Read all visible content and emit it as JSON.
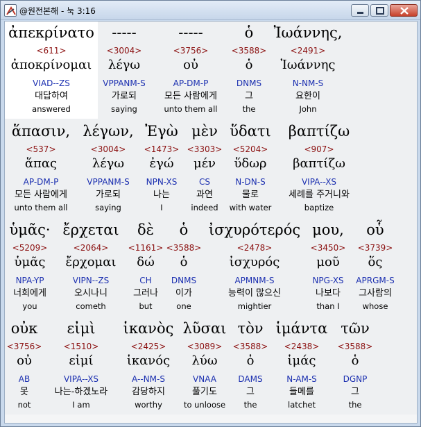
{
  "window": {
    "title": "@원전본해 - 눅 3:16"
  },
  "rows": [
    {
      "words": [
        {
          "surface": "ἀπεκρίνατο",
          "strong": "<611>",
          "lemma": "ἀποκρίνομαι",
          "morph": "VIAD--ZS",
          "korean": "대답하여",
          "english": "answered"
        },
        {
          "surface": "-----",
          "strong": "<3004>",
          "lemma": "λέγω",
          "morph": "VPPANM-S",
          "korean": "가로되",
          "english": "saying"
        },
        {
          "surface": "-----",
          "strong": "<3756>",
          "lemma": "οὐ",
          "morph": "AP-DM-P",
          "korean": "모든 사람에게",
          "english": "unto them all"
        },
        {
          "surface": "ὁ",
          "strong": "<3588>",
          "lemma": "ὁ",
          "morph": "DNMS",
          "korean": "그",
          "english": "the"
        },
        {
          "surface": "Ἰωάννης,",
          "strong": "<2491>",
          "lemma": "Ἰωάννης",
          "morph": "N-NM-S",
          "korean": "요한이",
          "english": "John"
        }
      ]
    },
    {
      "words": [
        {
          "surface": "ἅπασιν,",
          "strong": "<537>",
          "lemma": "ἅπας",
          "morph": "AP-DM-P",
          "korean": "모든 사람에게",
          "english": "unto them all"
        },
        {
          "surface": "λέγων,",
          "strong": "<3004>",
          "lemma": "λέγω",
          "morph": "VPPANM-S",
          "korean": "가로되",
          "english": "saying"
        },
        {
          "surface": "Ἐγὼ",
          "strong": "<1473>",
          "lemma": "ἐγώ",
          "morph": "NPN-XS",
          "korean": "나는",
          "english": "I"
        },
        {
          "surface": "μὲν",
          "strong": "<3303>",
          "lemma": "μέν",
          "morph": "CS",
          "korean": "과연",
          "english": "indeed"
        },
        {
          "surface": "ὕδατι",
          "strong": "<5204>",
          "lemma": "ὕδωρ",
          "morph": "N-DN-S",
          "korean": "물로",
          "english": "with water"
        },
        {
          "surface": "βαπτίζω",
          "strong": "<907>",
          "lemma": "βαπτίζω",
          "morph": "VIPA--XS",
          "korean": "세례를 주거니와",
          "english": "baptize"
        }
      ]
    },
    {
      "words": [
        {
          "surface": "ὑμᾶς·",
          "strong": "<5209>",
          "lemma": "ὑμᾶς",
          "morph": "NPA-YP",
          "korean": "너희에게",
          "english": "you"
        },
        {
          "surface": "ἔρχεται",
          "strong": "<2064>",
          "lemma": "ἔρχομαι",
          "morph": "VIPN--ZS",
          "korean": "오시나니",
          "english": "cometh"
        },
        {
          "surface": "δὲ",
          "strong": "<1161>",
          "lemma": "δώ",
          "morph": "CH",
          "korean": "그러나",
          "english": "but"
        },
        {
          "surface": "ὁ",
          "strong": "<3588>",
          "lemma": "ὁ",
          "morph": "DNMS",
          "korean": "이가",
          "english": "one"
        },
        {
          "surface": "ἰσχυρότερός",
          "strong": "<2478>",
          "lemma": "ἰσχυρός",
          "morph": "APMNM-S",
          "korean": "능력이 많으신",
          "english": "mightier"
        },
        {
          "surface": "μου,",
          "strong": "<3450>",
          "lemma": "μοῦ",
          "morph": "NPG-XS",
          "korean": "나보다",
          "english": "than I"
        },
        {
          "surface": "οὗ",
          "strong": "<3739>",
          "lemma": "ὅς",
          "morph": "APRGM-S",
          "korean": "그사람의",
          "english": "whose"
        }
      ]
    },
    {
      "words": [
        {
          "surface": "οὐκ",
          "strong": "<3756>",
          "lemma": "οὐ",
          "morph": "AB",
          "korean": "못",
          "english": "not"
        },
        {
          "surface": "εἰμὶ",
          "strong": "<1510>",
          "lemma": "εἰμί",
          "morph": "VIPA--XS",
          "korean": "나는-하겠노라",
          "english": "I am"
        },
        {
          "surface": "ἱκανὸς",
          "strong": "<2425>",
          "lemma": "ἱκανός",
          "morph": "A--NM-S",
          "korean": "감당하지",
          "english": "worthy"
        },
        {
          "surface": "λῦσαι",
          "strong": "<3089>",
          "lemma": "λύω",
          "morph": "VNAA",
          "korean": "풀기도",
          "english": "to unloose"
        },
        {
          "surface": "τὸν",
          "strong": "<3588>",
          "lemma": "ὁ",
          "morph": "DAMS",
          "korean": "그",
          "english": "the"
        },
        {
          "surface": "ἱμάντα",
          "strong": "<2438>",
          "lemma": "ἱμάς",
          "morph": "N-AM-S",
          "korean": "들메를",
          "english": "latchet"
        },
        {
          "surface": "τῶν",
          "strong": "<3588>",
          "lemma": "ὁ",
          "morph": "DGNP",
          "korean": "그",
          "english": "the"
        }
      ]
    }
  ]
}
